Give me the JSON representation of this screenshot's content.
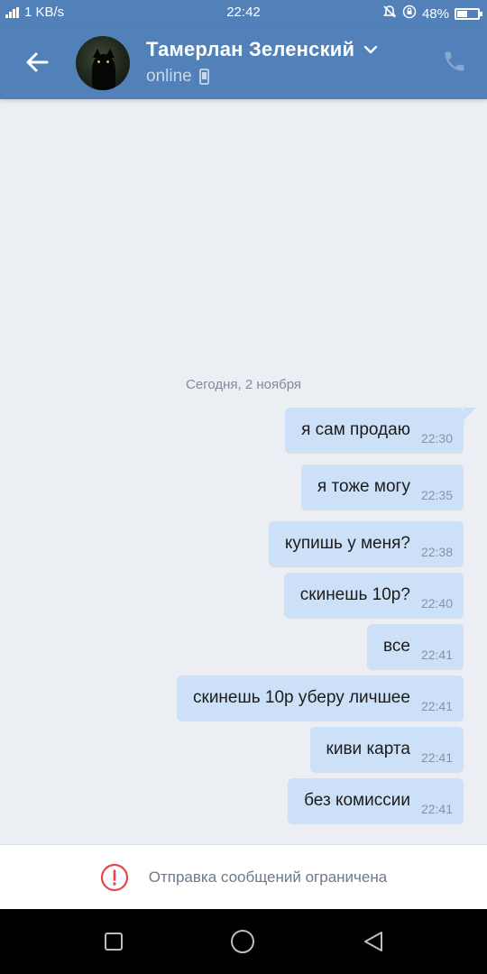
{
  "status_bar": {
    "speed": "1 KB/s",
    "time": "22:42",
    "battery": "48%",
    "battery_level": 0.48,
    "icons": [
      "signal-icon",
      "bell-muted-icon",
      "rotation-lock-icon",
      "battery-icon"
    ]
  },
  "header": {
    "contact_name": "Тамерлан Зеленский",
    "status": "online",
    "colors": {
      "header_bg": "#5181b8",
      "accent": "#ffffff"
    }
  },
  "chat": {
    "date_separator": "Сегодня, 2 ноября",
    "messages": [
      {
        "text": "я сам продаю",
        "time": "22:30"
      },
      {
        "text": "я тоже могу",
        "time": "22:35"
      },
      {
        "text": "купишь у меня?",
        "time": "22:38"
      },
      {
        "text": "скинешь 10р?",
        "time": "22:40"
      },
      {
        "text": "все",
        "time": "22:41"
      },
      {
        "text": "скинешь 10р уберу личшее",
        "time": "22:41"
      },
      {
        "text": "киви карта",
        "time": "22:41"
      },
      {
        "text": "без комиссии",
        "time": "22:41"
      }
    ],
    "colors": {
      "bubble": "#cce0f8",
      "background": "#ebeef2"
    }
  },
  "restriction": {
    "text": "Отправка сообщений ограничена",
    "color": "#e64646"
  }
}
